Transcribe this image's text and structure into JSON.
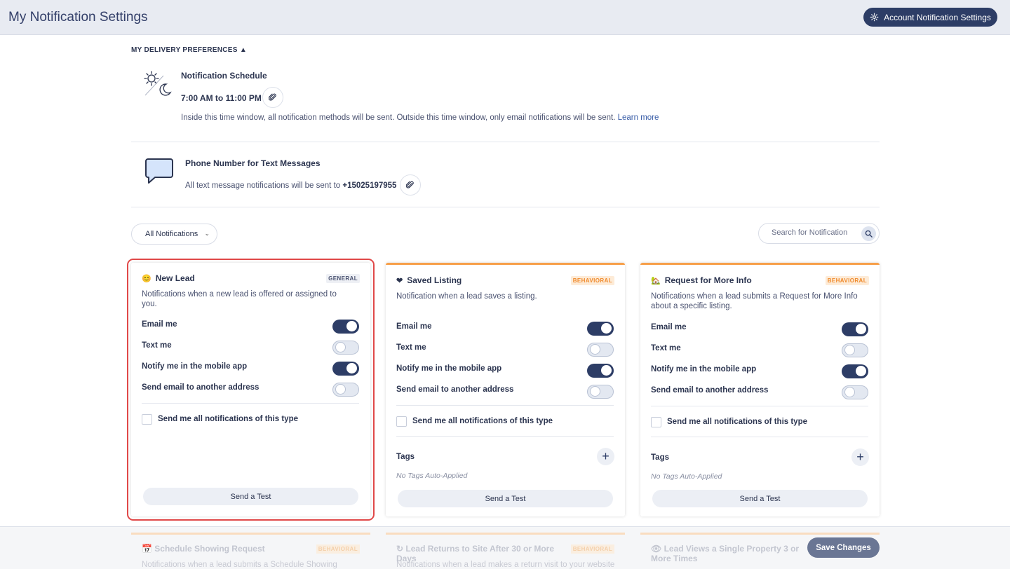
{
  "header": {
    "title": "My Notification Settings",
    "account_button": "Account Notification Settings"
  },
  "delivery": {
    "section_label": "MY DELIVERY PREFERENCES ▲",
    "schedule": {
      "title": "Notification Schedule",
      "time": "7:00 AM to 11:00 PM",
      "description": "Inside this time window, all notification methods will be sent. Outside this time window, only email notifications will be sent.",
      "learn_more": "Learn more"
    },
    "phone": {
      "title": "Phone Number for Text Messages",
      "description": "All text message notifications will be sent to",
      "number": "+15025197955"
    }
  },
  "filter": {
    "selected": "All Notifications"
  },
  "search": {
    "placeholder": "Search for Notification"
  },
  "option_labels": {
    "email": "Email me",
    "text": "Text me",
    "app": "Notify me in the mobile app",
    "other": "Send email to another address",
    "all": "Send me all notifications of this type",
    "tags": "Tags",
    "no_tags": "No Tags Auto-Applied",
    "send_test": "Send a Test"
  },
  "cards": [
    {
      "title": "New Lead",
      "emoji": "😊",
      "badge": "GENERAL",
      "description": "Notifications when a new lead is offered or assigned to you.",
      "email": true,
      "text": false,
      "app": true,
      "other": false,
      "all": false,
      "selected": true
    },
    {
      "title": "Saved Listing",
      "emoji": "❤",
      "badge": "BEHAVIORAL",
      "description": "Notification when a lead saves a listing.",
      "email": true,
      "text": false,
      "app": true,
      "other": false,
      "all": false,
      "selected": false
    },
    {
      "title": "Request for More Info",
      "emoji": "🏡",
      "badge": "BEHAVIORAL",
      "description": "Notifications when a lead submits a Request for More Info about a specific listing.",
      "email": true,
      "text": false,
      "app": true,
      "other": false,
      "all": false,
      "selected": false
    }
  ],
  "footer_cards": [
    {
      "emoji": "📅",
      "title": "Schedule Showing Request",
      "badge": "BEHAVIORAL",
      "description": "Notifications when a lead submits a Schedule Showing"
    },
    {
      "emoji": "↻",
      "title": "Lead Returns to Site After 30 or More Days",
      "badge": "BEHAVIORAL",
      "description": "Notifications when a lead makes a return visit to your website"
    },
    {
      "emoji": "👁",
      "title": "Lead Views a Single Property 3 or More Times",
      "badge": "",
      "description": ""
    }
  ],
  "save_button": "Save Changes",
  "colors": {
    "primary": "#2d3d66",
    "behavioral_accent": "#f7a04a",
    "selection_outline": "#e04848"
  }
}
